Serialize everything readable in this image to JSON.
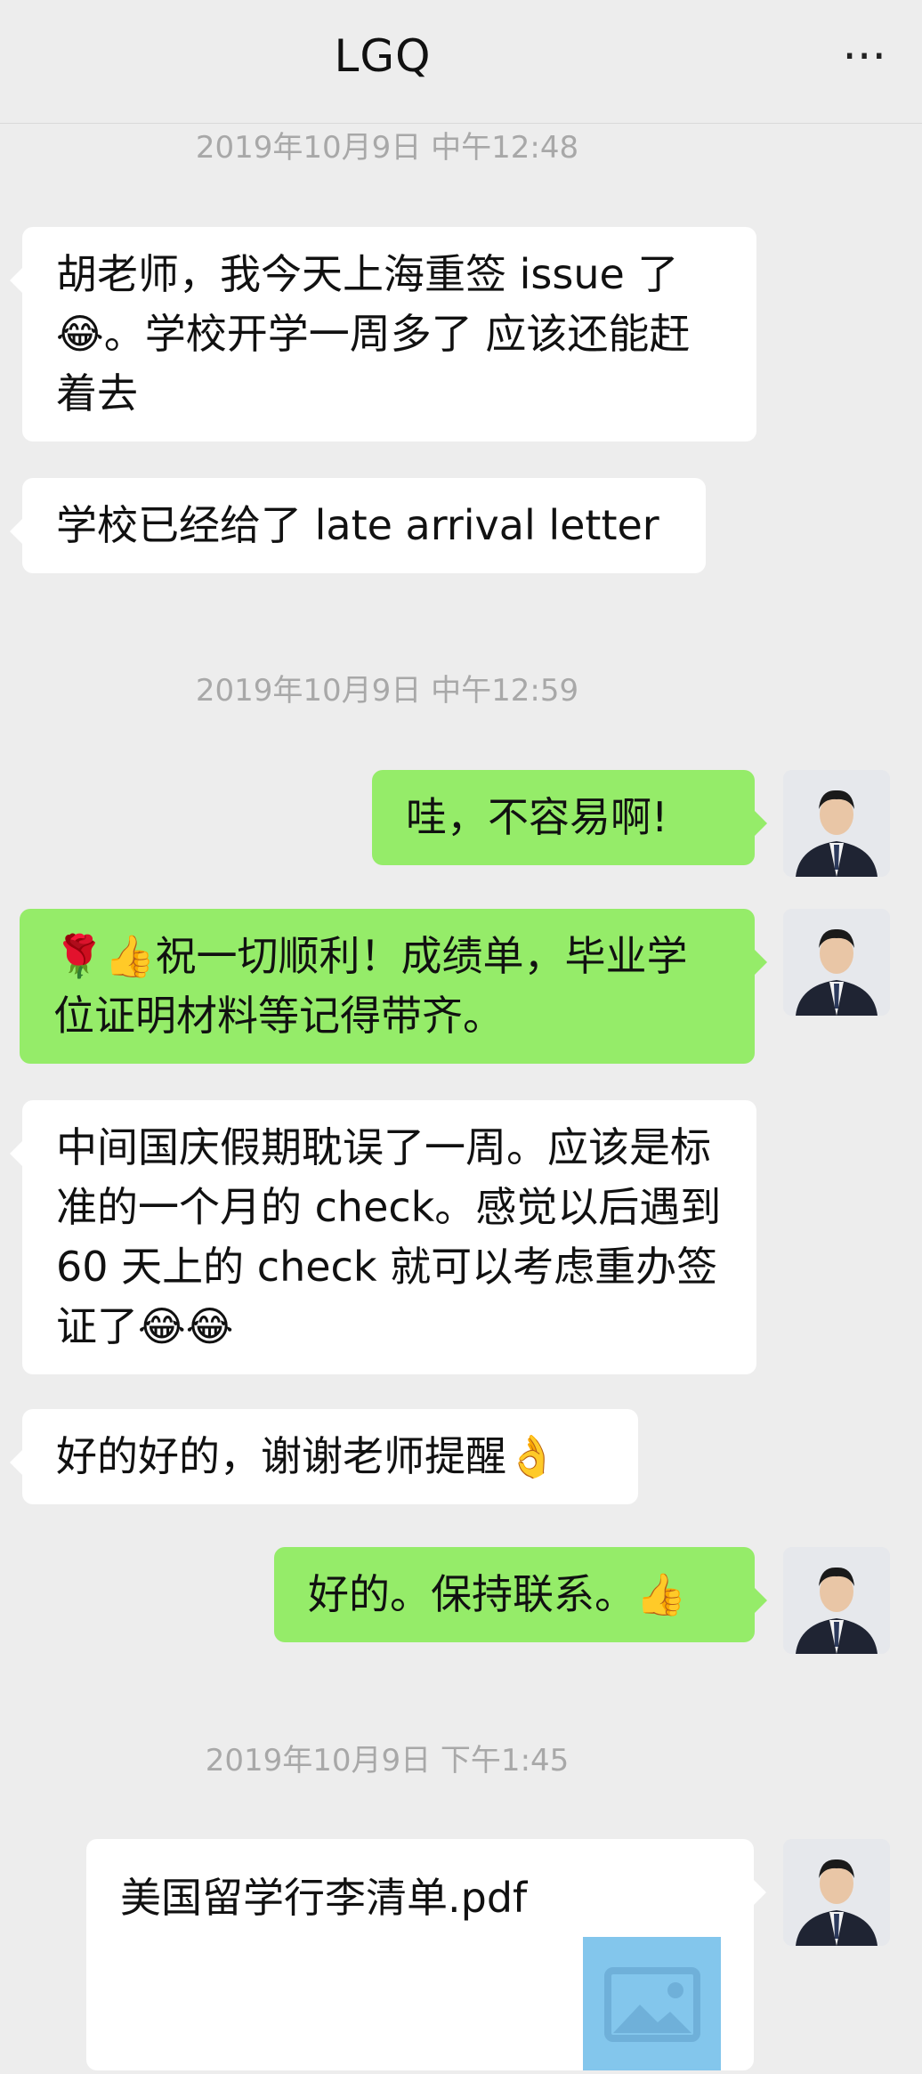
{
  "header": {
    "title": "LGQ",
    "more_icon": "more-dots-icon"
  },
  "timestamps": [
    "2019年10月9日 中午12:48",
    "2019年10月9日 中午12:59",
    "2019年10月9日 下午1:45"
  ],
  "messages": [
    {
      "side": "in",
      "text": "胡老师，我今天上海重签 issue 了😂。学校开学一周多了 应该还能赶着去"
    },
    {
      "side": "in",
      "text": "学校已经给了 late arrival letter"
    },
    {
      "side": "out",
      "text": "哇，不容易啊!"
    },
    {
      "side": "out",
      "text": "🌹👍祝一切顺利！成绩单，毕业学位证明材料等记得带齐。"
    },
    {
      "side": "in",
      "text": "中间国庆假期耽误了一周。应该是标准的一个月的 check。感觉以后遇到 60 天上的 check 就可以考虑重办签证了😂😂"
    },
    {
      "side": "in",
      "text": "好的好的，谢谢老师提醒👌"
    },
    {
      "side": "out",
      "text": "好的。保持联系。👍"
    }
  ],
  "file_message": {
    "filename": "美国留学行李清单.pdf",
    "thumbnail_icon": "image-placeholder-icon"
  },
  "colors": {
    "background": "#ededed",
    "incoming_bubble": "#ffffff",
    "outgoing_bubble": "#95ec69"
  }
}
